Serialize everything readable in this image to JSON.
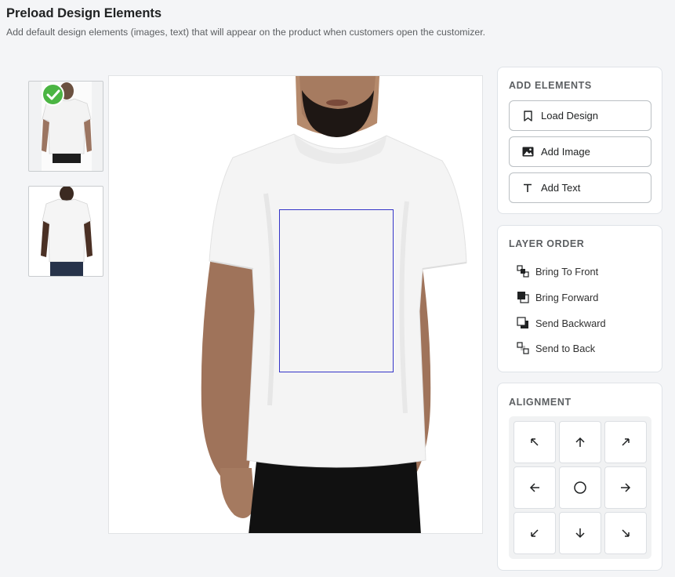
{
  "header": {
    "title": "Preload Design Elements",
    "subtitle": "Add default design elements (images, text) that will appear on the product when customers open the customizer."
  },
  "views": [
    {
      "name": "front",
      "selected": true
    },
    {
      "name": "back",
      "selected": false
    }
  ],
  "add_elements": {
    "title": "ADD ELEMENTS",
    "buttons": [
      {
        "label": "Load Design",
        "icon": "bookmark-icon"
      },
      {
        "label": "Add Image",
        "icon": "image-icon"
      },
      {
        "label": "Add Text",
        "icon": "text-icon"
      }
    ]
  },
  "layer_order": {
    "title": "LAYER ORDER",
    "items": [
      {
        "label": "Bring To Front",
        "icon": "bring-to-front-icon"
      },
      {
        "label": "Bring Forward",
        "icon": "bring-forward-icon"
      },
      {
        "label": "Send Backward",
        "icon": "send-backward-icon"
      },
      {
        "label": "Send to Back",
        "icon": "send-to-back-icon"
      }
    ]
  },
  "alignment": {
    "title": "ALIGNMENT",
    "buttons": [
      "top-left",
      "top",
      "top-right",
      "left",
      "center",
      "right",
      "bottom-left",
      "bottom",
      "bottom-right"
    ]
  },
  "colors": {
    "design_area_border": "#3434c8",
    "check_badge": "#4bb543"
  }
}
